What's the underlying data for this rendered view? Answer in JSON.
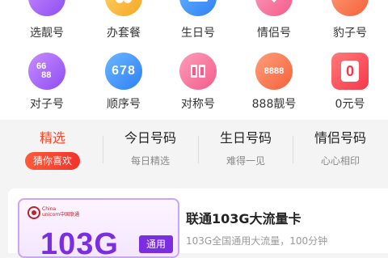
{
  "grid": {
    "row1": [
      {
        "label": "选靓号",
        "icon": "card-icon",
        "color": "#a86cf7"
      },
      {
        "label": "办套餐",
        "icon": "package-icon",
        "color": "#f8b73a"
      },
      {
        "label": "生日号",
        "icon": "calendar-icon",
        "color": "#4a9bf8"
      },
      {
        "label": "情侣号",
        "icon": "heart-icon",
        "color": "#f46f99"
      },
      {
        "label": "豹子号",
        "icon": "leopard-icon",
        "color": "#f5734a"
      }
    ],
    "row2": [
      {
        "label": "对子号",
        "icon_text": "66 88",
        "icon": "pair-icon",
        "color": "#a86cf7"
      },
      {
        "label": "顺序号",
        "icon_text": "678",
        "icon": "sequence-icon",
        "color": "#4a9bf8"
      },
      {
        "label": "对称号",
        "icon_text": "",
        "icon": "symmetric-icon",
        "color": "#f46f99"
      },
      {
        "label": "888靓号",
        "icon_text": "8888",
        "icon": "lucky-888-icon",
        "color": "#f5734a"
      },
      {
        "label": "0元号",
        "icon_text": "0",
        "icon": "zero-icon",
        "color": "#f5384a"
      }
    ]
  },
  "tabs": [
    {
      "title": "精选",
      "subtitle": "猜你喜欢",
      "active": true
    },
    {
      "title": "今日号码",
      "subtitle": "每日精选"
    },
    {
      "title": "生日号码",
      "subtitle": "难得一见"
    },
    {
      "title": "情侣号码",
      "subtitle": "心心相印"
    }
  ],
  "product": {
    "title": "联通103G大流量卡",
    "subtitle": "103G全国通用大流量，100分钟",
    "image_number": "103G",
    "image_tag": "通用",
    "brand_line1": "China",
    "brand_line2": "unicom中国联通"
  },
  "colors": {
    "accent": "#f04a2a",
    "purple": "#7b2ee0"
  }
}
